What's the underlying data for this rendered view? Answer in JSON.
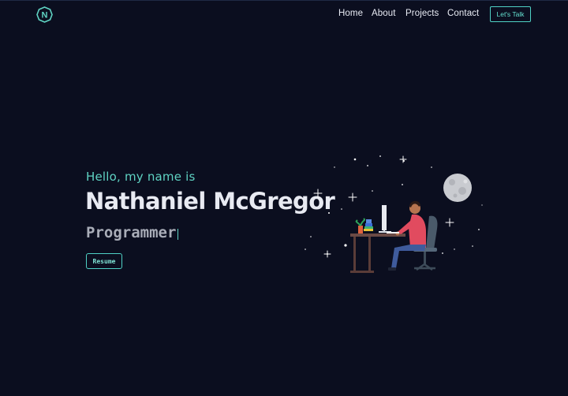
{
  "nav": {
    "logo_letter": "N",
    "links": [
      "Home",
      "About",
      "Projects",
      "Contact"
    ],
    "cta_label": "Let's Talk"
  },
  "hero": {
    "greeting": "Hello, my name is",
    "name": "Nathaniel McGregor",
    "role": "Programmer",
    "resume_label": "Resume"
  },
  "illustration": {
    "icon": "developer-at-desk-illustration"
  },
  "colors": {
    "background": "#0b0e1f",
    "accent": "#5fd3c3",
    "text": "#e8eaf2",
    "muted": "#a9adb8"
  }
}
